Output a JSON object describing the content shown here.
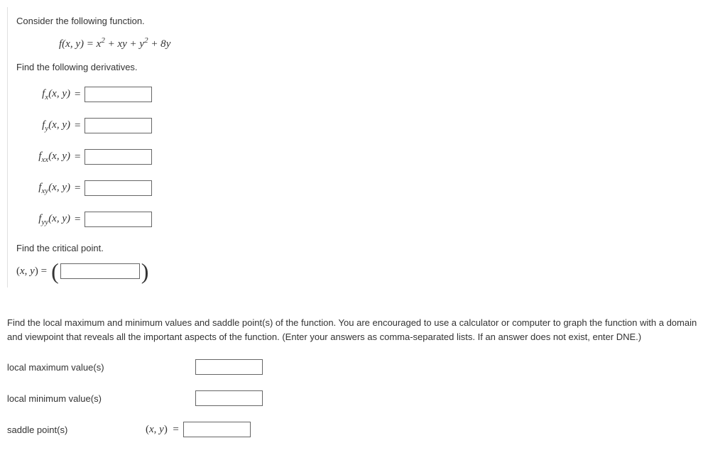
{
  "intro": "Consider the following function.",
  "function": "f(x, y) = x² + xy + y² + 8y",
  "find_derivs": "Find the following derivatives.",
  "derivs": {
    "fx": {
      "sub": "x",
      "args": "(x, y)",
      "value": ""
    },
    "fy": {
      "sub": "y",
      "args": "(x, y)",
      "value": ""
    },
    "fxx": {
      "sub": "xx",
      "args": "(x, y)",
      "value": ""
    },
    "fxy": {
      "sub": "xy",
      "args": "(x, y)",
      "value": ""
    },
    "fyy": {
      "sub": "yy",
      "args": "(x, y)",
      "value": ""
    }
  },
  "find_crit": "Find the critical point.",
  "crit": {
    "label": "(x, y) =",
    "value": ""
  },
  "extrema_text": "Find the local maximum and minimum values and saddle point(s) of the function. You are encouraged to use a calculator or computer to graph the function with a domain and viewpoint that reveals all the important aspects of the function. (Enter your answers as comma-separated lists. If an answer does not exist, enter DNE.)",
  "labels": {
    "local_max": "local maximum value(s)",
    "local_min": "local minimum value(s)",
    "saddle": "saddle point(s)",
    "saddle_xy": "(x, y)  ="
  },
  "values": {
    "local_max": "",
    "local_min": "",
    "saddle": ""
  }
}
